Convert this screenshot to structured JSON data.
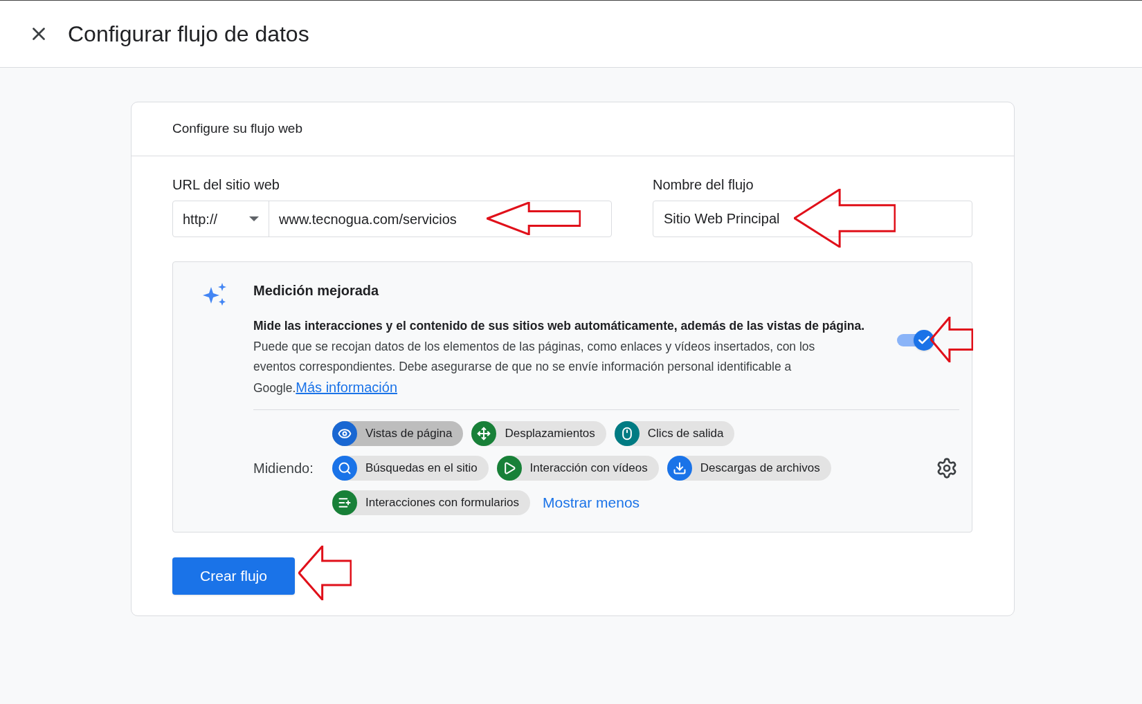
{
  "header": {
    "title": "Configurar flujo de datos"
  },
  "card": {
    "title": "Configure su flujo web"
  },
  "url_field": {
    "label": "URL del sitio web",
    "protocol": "http://",
    "value": "www.tecnogua.com/servicios"
  },
  "name_field": {
    "label": "Nombre del flujo",
    "value": "Sitio Web Principal"
  },
  "enhanced_measurement": {
    "title": "Medición mejorada",
    "lead": "Mide las interacciones y el contenido de sus sitios web automáticamente, además de las vistas de página.",
    "description": "Puede que se recojan datos de los elementos de las páginas, como enlaces y vídeos insertados, con los eventos correspondientes. Debe asegurarse de que no se envíe información personal identificable a Google.",
    "link": "Más información",
    "on": true,
    "measuring_label": "Midiendo:",
    "chips": [
      {
        "label": "Vistas de página",
        "kind": "eye",
        "color": "#1967d2",
        "selected": true
      },
      {
        "label": "Desplazamientos",
        "kind": "scroll",
        "color": "#188038",
        "selected": false
      },
      {
        "label": "Clics de salida",
        "kind": "mouse",
        "color": "#007b83",
        "selected": false
      },
      {
        "label": "Búsquedas en el sitio",
        "kind": "search",
        "color": "#1a73e8",
        "selected": false
      },
      {
        "label": "Interacción con vídeos",
        "kind": "play",
        "color": "#188038",
        "selected": false
      },
      {
        "label": "Descargas de archivos",
        "kind": "download",
        "color": "#1a73e8",
        "selected": false
      },
      {
        "label": "Interacciones con formularios",
        "kind": "form",
        "color": "#188038",
        "selected": false
      }
    ],
    "toggle_link": "Mostrar menos"
  },
  "primary_button": "Crear flujo"
}
